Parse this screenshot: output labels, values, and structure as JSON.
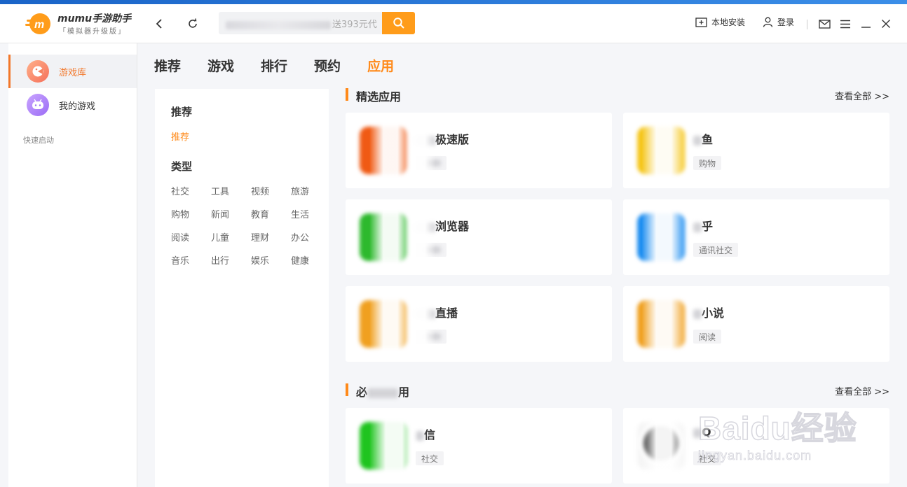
{
  "app": {
    "brand_name": "mumu手游助手",
    "brand_sub": "「模拟器升级版」",
    "accent_color": "#ff8a1a",
    "logo_icon": "mumu-logo-icon"
  },
  "header": {
    "search_visible_text": "送393元代",
    "local_install_label": "本地安装",
    "login_label": "登录"
  },
  "sidebar": {
    "items": [
      {
        "label": "游戏库",
        "icon": "game-library-icon",
        "active": true
      },
      {
        "label": "我的游戏",
        "icon": "my-games-icon",
        "active": false
      }
    ],
    "quick_launch_label": "快速启动"
  },
  "tabs": [
    {
      "label": "推荐",
      "active": false
    },
    {
      "label": "游戏",
      "active": false
    },
    {
      "label": "排行",
      "active": false
    },
    {
      "label": "预约",
      "active": false
    },
    {
      "label": "应用",
      "active": true
    }
  ],
  "category_panel": {
    "recommend_heading": "推荐",
    "recommend_link": "推荐",
    "type_heading": "类型",
    "types": [
      "社交",
      "工具",
      "视频",
      "旅游",
      "购物",
      "新闻",
      "教育",
      "生活",
      "阅读",
      "儿童",
      "理财",
      "办公",
      "音乐",
      "出行",
      "娱乐",
      "健康"
    ]
  },
  "sections": [
    {
      "title": "精选应用",
      "see_all": "查看全部 >>",
      "apps": [
        {
          "name_visible": "极速版",
          "tag_visible": "",
          "icon_color": "#f05a14"
        },
        {
          "name_visible": "鱼",
          "tag_visible": "购物",
          "icon_color": "#f5c518"
        },
        {
          "name_visible": "浏览器",
          "tag_visible": "",
          "icon_color": "#2db92d"
        },
        {
          "name_visible": "乎",
          "tag_visible": "通讯社交",
          "icon_color": "#1a8cf0"
        },
        {
          "name_visible": "直播",
          "tag_visible": "",
          "icon_color": "#f0a020"
        },
        {
          "name_visible": "小说",
          "tag_visible": "阅读",
          "icon_color": "#f0a020"
        }
      ]
    },
    {
      "title_visible": "必",
      "title_visible_end": "用",
      "see_all": "查看全部 >>",
      "apps": [
        {
          "name_visible": "信",
          "tag_visible": "社交",
          "icon_color": "#1fc41f"
        },
        {
          "name_visible": "Q",
          "tag_visible": "社交",
          "icon_color": "#222222"
        }
      ]
    }
  ],
  "watermark": {
    "big_text": "Baidu经验",
    "small_text": "jingyan.baidu.com"
  }
}
